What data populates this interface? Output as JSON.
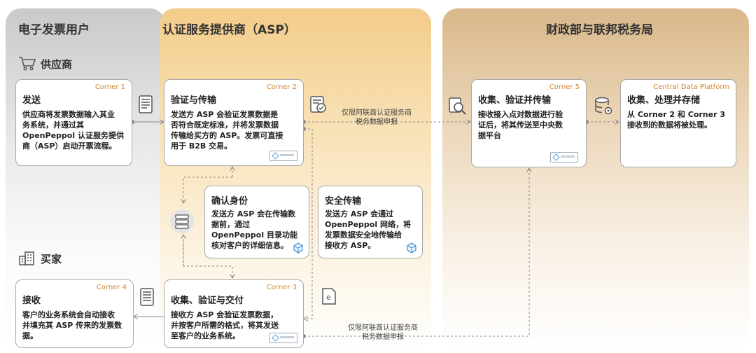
{
  "sections": {
    "users": "电子发票用户",
    "asp": "认证服务提供商（ASP）",
    "gov": "财政部与联邦税务局"
  },
  "supplier": "供应商",
  "buyer": "买家",
  "corner1": {
    "tag": "Corner 1",
    "title": "发送",
    "desc": "供应商将发票数据输入其业\n务系统，并通过其\nOpenPeppol 认证服务提供\n商（ASP）启动开票流程。"
  },
  "corner2": {
    "tag": "Corner 2",
    "title": "验证与传输",
    "desc": "发送方 ASP 会验证发票数据是\n否符合既定标准，并将发票数据\n传输给买方的 ASP。发票可直接\n用于 B2B 交易。"
  },
  "identity": {
    "title": "确认身份",
    "desc": "发送方 ASP 会在传输数\n据前，通过\nOpenPeppol 目录功能\n核对客户的详细信息。"
  },
  "secure": {
    "title": "安全传输",
    "desc": "发送方 ASP 会通过\nOpenPeppol 网络，将\n发票数据安全地传输给\n接收方 ASP。"
  },
  "corner3": {
    "tag": "Corner 3",
    "title": "收集、验证与交付",
    "desc": "接收方 ASP 会验证发票数据，\n并按客户所需的格式，将其发送\n至客户的业务系统。"
  },
  "corner4": {
    "tag": "Corner 4",
    "title": "接收",
    "desc": "客户的业务系统会自动接收\n并填充其 ASP 传来的发票数\n据。"
  },
  "corner5": {
    "tag": "Corner 5",
    "title": "收集、验证并传输",
    "desc": "接收接入点对数据进行验\n证后，将其传送至中央数\n据平台"
  },
  "cdp": {
    "tag": "Central Data Platform",
    "title": "收集、处理并存储",
    "desc": "从 Corner 2 和 Corner 3\n接收到的数据将被处理。"
  },
  "note_top": "仅限阿联酋认证服务商\n税务数据申报",
  "note_bottom": "仅限阿联酋认证服务商\n税务数据申报",
  "colors": {
    "accent": "#d2862d",
    "line": "#8a8a8a",
    "icon": "#555555"
  }
}
